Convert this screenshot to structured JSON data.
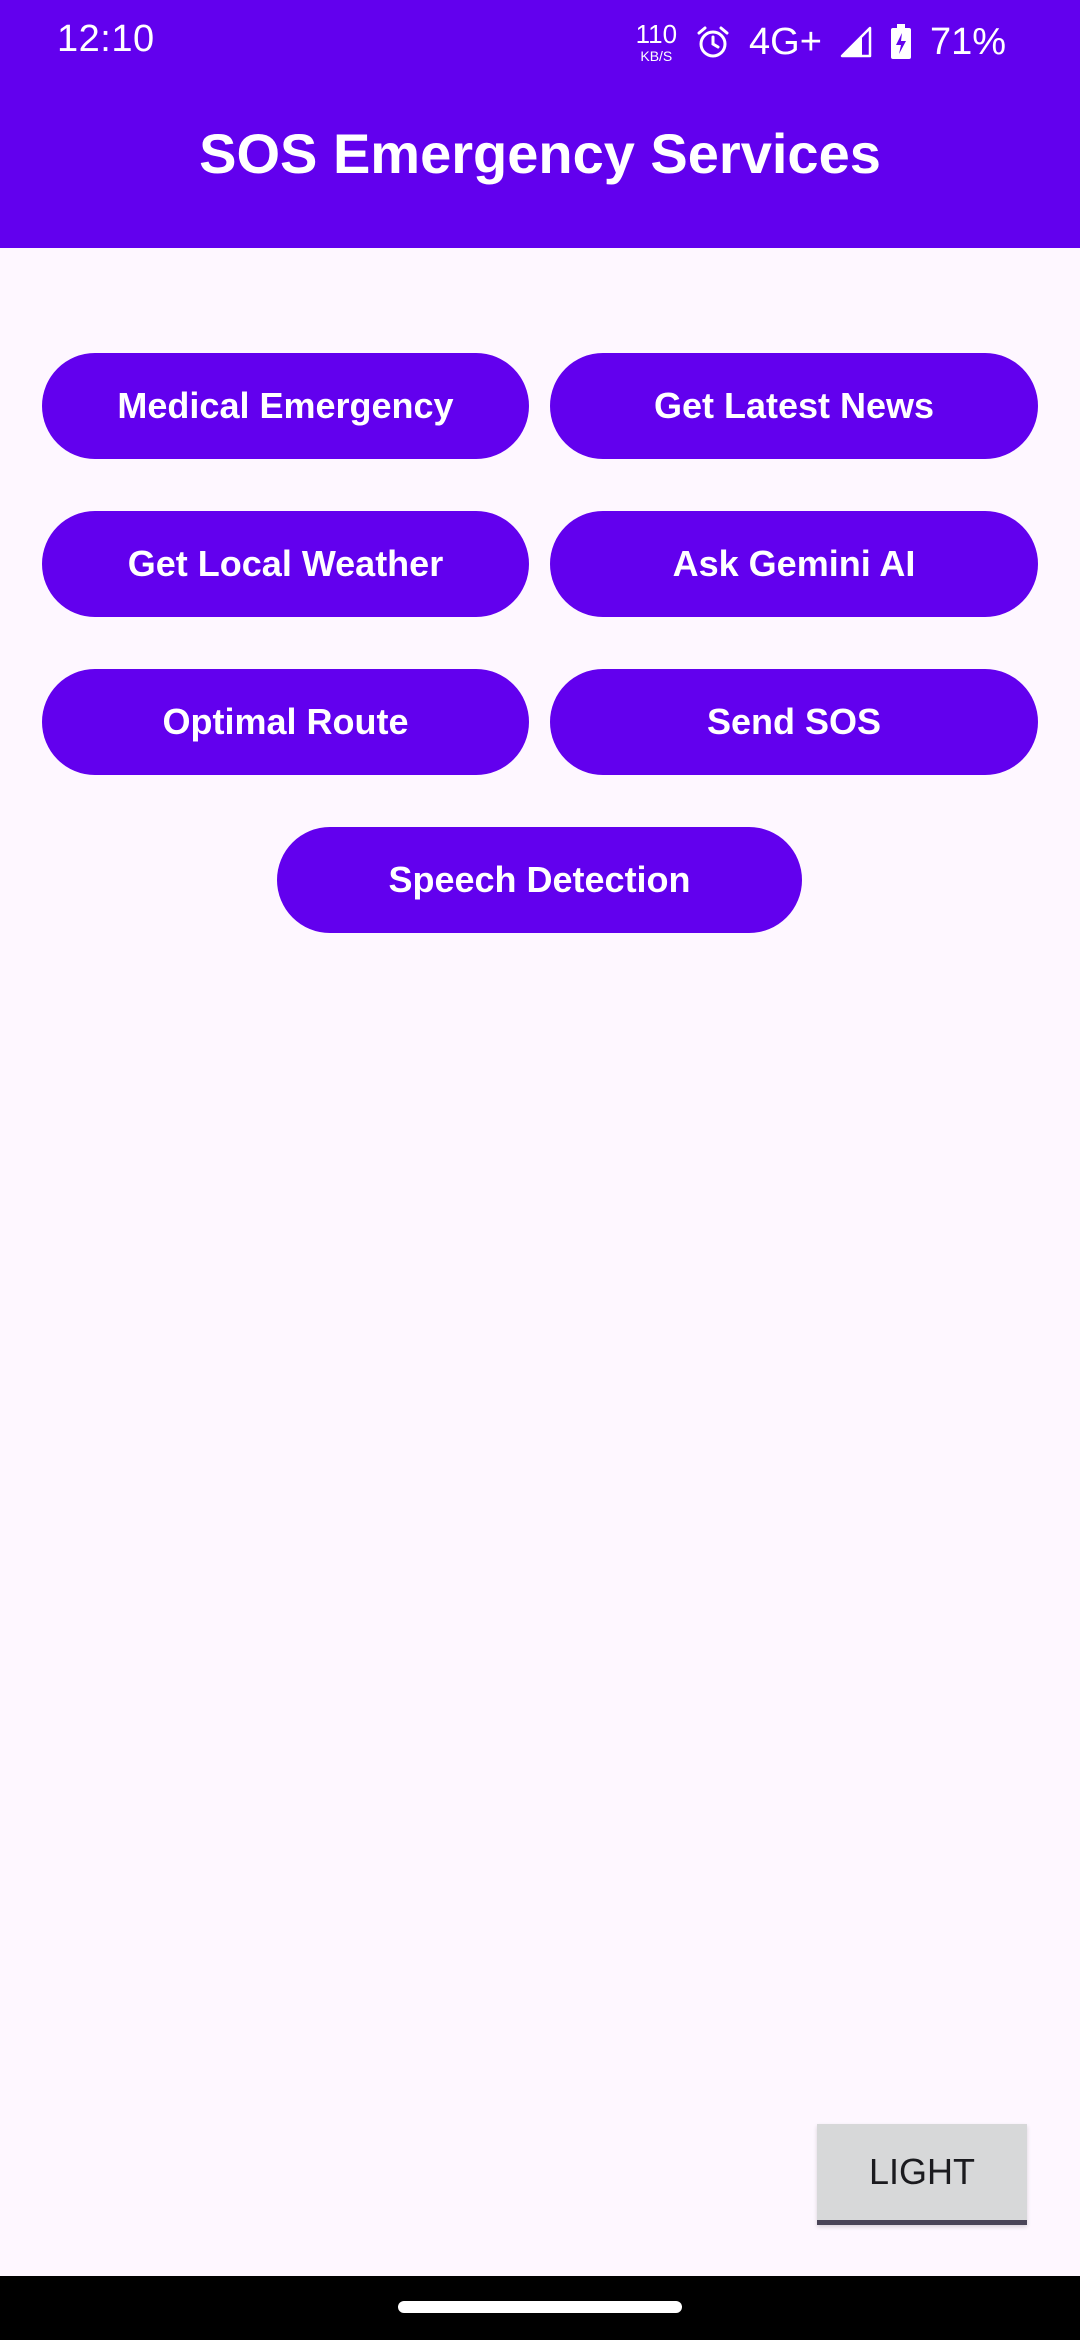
{
  "status_bar": {
    "time": "12:10",
    "speed_value": "110",
    "speed_unit": "KB/S",
    "network": "4G+",
    "battery": "71%",
    "icons": [
      "alarm-icon",
      "signal-icon",
      "battery-charging-icon"
    ]
  },
  "app_bar": {
    "title": "SOS Emergency Services"
  },
  "buttons": {
    "medical_emergency": "Medical Emergency",
    "latest_news": "Get Latest News",
    "local_weather": "Get Local Weather",
    "ask_gemini": "Ask Gemini AI",
    "optimal_route": "Optimal Route",
    "send_sos": "Send SOS",
    "speech_detection": "Speech Detection"
  },
  "theme_toggle": {
    "label": "LIGHT"
  },
  "colors": {
    "primary": "#6200EE",
    "background": "#FEF7FF",
    "on_primary": "#FFFFFF",
    "toggle_background": "#D7D8D9"
  }
}
